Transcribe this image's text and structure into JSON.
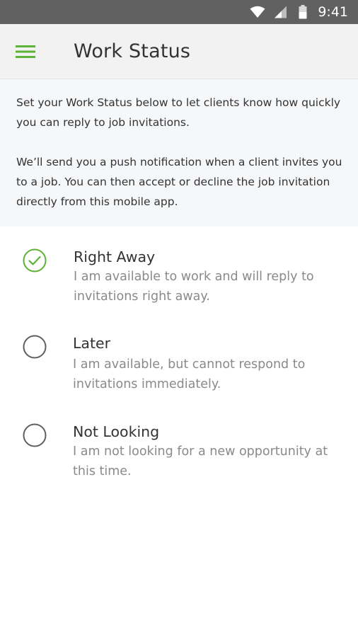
{
  "status_bar": {
    "time": "9:41"
  },
  "app_bar": {
    "title": "Work Status"
  },
  "intro": {
    "paragraph_1": "Set your Work Status below to let clients know how quickly you can reply to job invitations.",
    "paragraph_2": "We’ll send you a push notification when a client invites you to a job. You can then accept or decline the job invitation directly from this mobile app."
  },
  "options": [
    {
      "title": "Right Away",
      "description": "I am available to work and will reply to invitations right away.",
      "selected": true
    },
    {
      "title": "Later",
      "description": "I am available, but cannot respond to invitations immediately.",
      "selected": false
    },
    {
      "title": "Not Looking",
      "description": "I am not looking for a new opportunity at this time.",
      "selected": false
    }
  ],
  "colors": {
    "accent": "#5cb335",
    "status_bar": "#616161",
    "app_bar": "#f2f2f2",
    "intro_bg": "#f6f7f9",
    "text_primary": "#333333",
    "text_secondary": "#8a8a8a"
  }
}
